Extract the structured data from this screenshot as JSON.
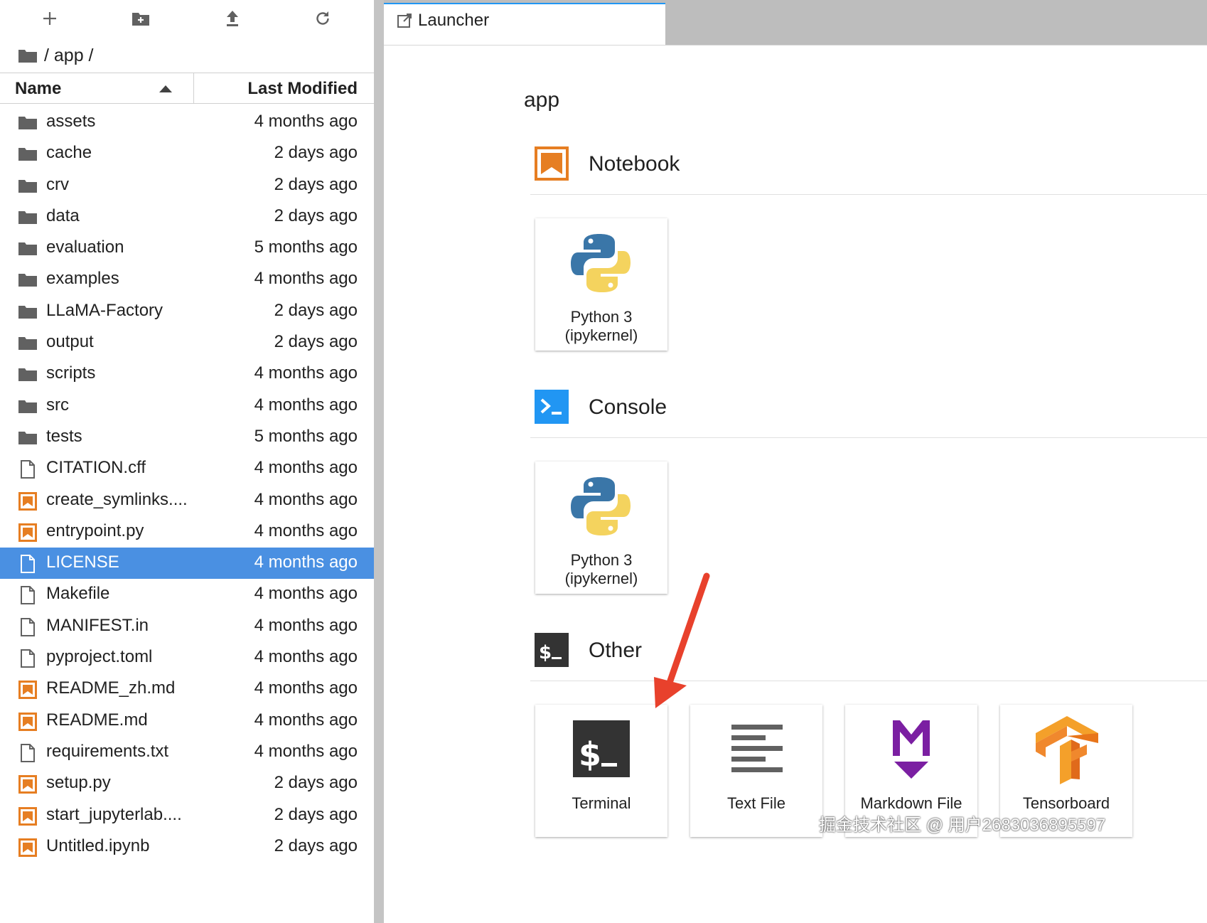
{
  "filebrowser": {
    "toolbar": {
      "new_launcher_icon": "plus-icon",
      "new_folder_icon": "new-folder-icon",
      "upload_icon": "upload-icon",
      "refresh_icon": "refresh-icon"
    },
    "breadcrumb": "/ app /",
    "columns": {
      "name": "Name",
      "modified": "Last Modified",
      "sort": "ascending"
    },
    "items": [
      {
        "name": "assets",
        "modified": "4 months ago",
        "type": "folder"
      },
      {
        "name": "cache",
        "modified": "2 days ago",
        "type": "folder"
      },
      {
        "name": "crv",
        "modified": "2 days ago",
        "type": "folder"
      },
      {
        "name": "data",
        "modified": "2 days ago",
        "type": "folder"
      },
      {
        "name": "evaluation",
        "modified": "5 months ago",
        "type": "folder"
      },
      {
        "name": "examples",
        "modified": "4 months ago",
        "type": "folder"
      },
      {
        "name": "LLaMA-Factory",
        "modified": "2 days ago",
        "type": "folder"
      },
      {
        "name": "output",
        "modified": "2 days ago",
        "type": "folder"
      },
      {
        "name": "scripts",
        "modified": "4 months ago",
        "type": "folder"
      },
      {
        "name": "src",
        "modified": "4 months ago",
        "type": "folder"
      },
      {
        "name": "tests",
        "modified": "5 months ago",
        "type": "folder"
      },
      {
        "name": "CITATION.cff",
        "modified": "4 months ago",
        "type": "file"
      },
      {
        "name": "create_symlinks....",
        "modified": "4 months ago",
        "type": "script"
      },
      {
        "name": "entrypoint.py",
        "modified": "4 months ago",
        "type": "script"
      },
      {
        "name": "LICENSE",
        "modified": "4 months ago",
        "type": "file",
        "selected": true
      },
      {
        "name": "Makefile",
        "modified": "4 months ago",
        "type": "file"
      },
      {
        "name": "MANIFEST.in",
        "modified": "4 months ago",
        "type": "file"
      },
      {
        "name": "pyproject.toml",
        "modified": "4 months ago",
        "type": "file"
      },
      {
        "name": "README_zh.md",
        "modified": "4 months ago",
        "type": "script"
      },
      {
        "name": "README.md",
        "modified": "4 months ago",
        "type": "script"
      },
      {
        "name": "requirements.txt",
        "modified": "4 months ago",
        "type": "file"
      },
      {
        "name": "setup.py",
        "modified": "2 days ago",
        "type": "script"
      },
      {
        "name": "start_jupyterlab....",
        "modified": "2 days ago",
        "type": "script"
      },
      {
        "name": "Untitled.ipynb",
        "modified": "2 days ago",
        "type": "script"
      }
    ]
  },
  "tabs": [
    {
      "label": "Launcher",
      "icon": "launch-icon"
    }
  ],
  "launcher": {
    "cwd": "app",
    "sections": {
      "notebook": {
        "title": "Notebook",
        "icon": "notebook-icon",
        "cards": [
          {
            "line1": "Python 3",
            "line2": "(ipykernel)",
            "icon": "python-icon"
          }
        ]
      },
      "console": {
        "title": "Console",
        "icon": "console-icon",
        "cards": [
          {
            "line1": "Python 3",
            "line2": "(ipykernel)",
            "icon": "python-icon"
          }
        ]
      },
      "other": {
        "title": "Other",
        "icon": "terminal-icon",
        "cards": [
          {
            "label": "Terminal",
            "icon": "terminal-icon"
          },
          {
            "label": "Text File",
            "icon": "text-file-icon"
          },
          {
            "label": "Markdown File",
            "icon": "markdown-icon"
          },
          {
            "label": "Tensorboard",
            "icon": "tensorboard-icon"
          }
        ]
      }
    }
  },
  "annotation": {
    "arrow_color": "#e8412c",
    "target": "Terminal"
  },
  "watermark": "掘金技术社区 @ 用户2683036895597",
  "colors": {
    "selection": "#4a90e2",
    "notebook_orange": "#e67e22",
    "console_blue": "#2196f3",
    "terminal_dark": "#333333",
    "markdown_purple": "#7b1fa2"
  }
}
